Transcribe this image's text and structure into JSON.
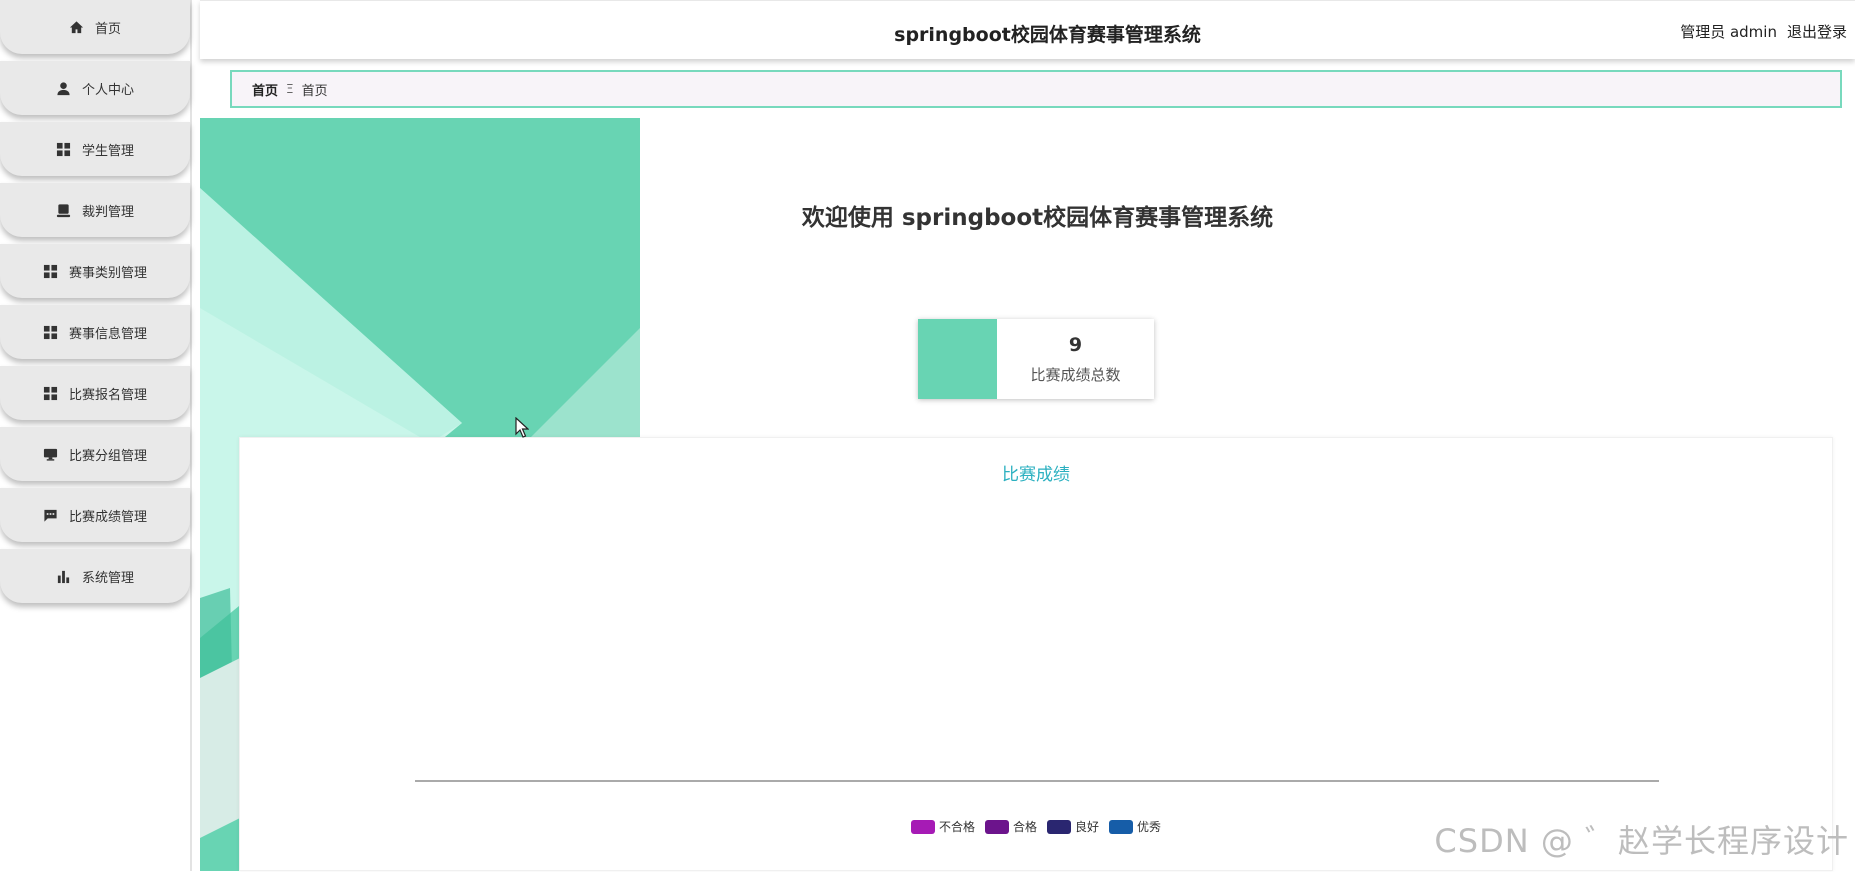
{
  "sidebar": {
    "items": [
      {
        "label": "首页",
        "icon": "home-icon"
      },
      {
        "label": "个人中心",
        "icon": "user-icon"
      },
      {
        "label": "学生管理",
        "icon": "grid-icon"
      },
      {
        "label": "裁判管理",
        "icon": "tray-icon"
      },
      {
        "label": "赛事类别管理",
        "icon": "grid-icon"
      },
      {
        "label": "赛事信息管理",
        "icon": "grid-icon"
      },
      {
        "label": "比赛报名管理",
        "icon": "grid-icon"
      },
      {
        "label": "比赛分组管理",
        "icon": "monitor-icon"
      },
      {
        "label": "比赛成绩管理",
        "icon": "chat-icon"
      },
      {
        "label": "系统管理",
        "icon": "bar-chart-icon"
      }
    ]
  },
  "header": {
    "title": "springboot校园体育赛事管理系统",
    "user_label": "管理员 admin",
    "logout_label": "退出登录"
  },
  "breadcrumb": {
    "home": "首页",
    "separator": "Ξ",
    "current": "首页"
  },
  "welcome": "欢迎使用 springboot校园体育赛事管理系统",
  "stat": {
    "value": "9",
    "label": "比赛成绩总数",
    "color": "#68d4b3"
  },
  "chart_data": {
    "type": "bar",
    "title": "比赛成绩",
    "categories": [],
    "series": [
      {
        "name": "不合格",
        "color": "#a61bb5",
        "values": []
      },
      {
        "name": "合格",
        "color": "#6c148c",
        "values": []
      },
      {
        "name": "良好",
        "color": "#2a2670",
        "values": []
      },
      {
        "name": "优秀",
        "color": "#165da8",
        "values": []
      }
    ],
    "legend": "bottom-center"
  },
  "watermark": "CSDN @ ゛赵学长程序设计"
}
